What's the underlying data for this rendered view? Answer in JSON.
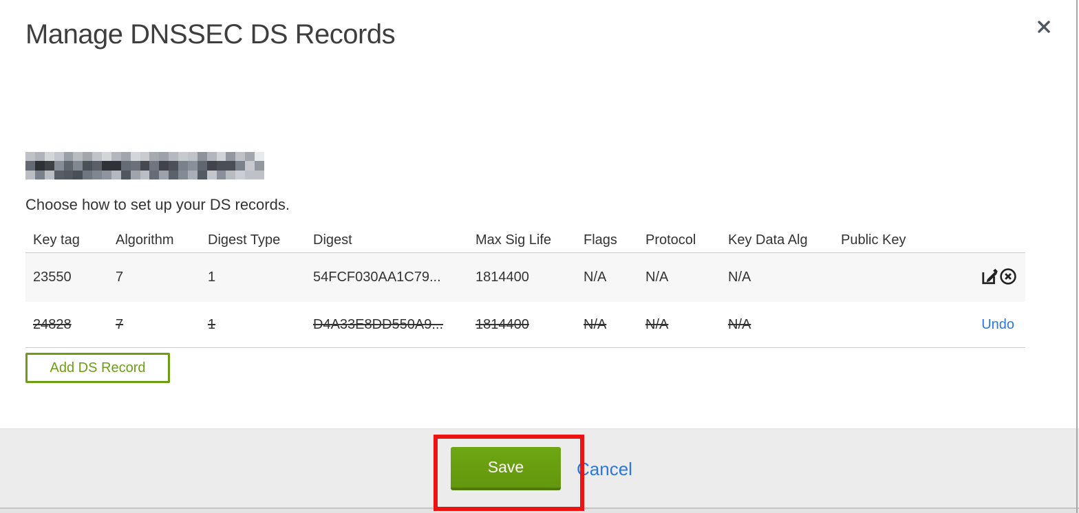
{
  "modal": {
    "title": "Manage DNSSEC DS Records",
    "close_icon": "x-icon",
    "domain": {
      "redacted": true
    },
    "subtitle": "Choose how to set up your DS records.",
    "table": {
      "columns": [
        "Key tag",
        "Algorithm",
        "Digest Type",
        "Digest",
        "Max Sig Life",
        "Flags",
        "Protocol",
        "Key Data Alg",
        "Public Key"
      ],
      "rows": [
        {
          "key_tag": "23550",
          "algorithm": "7",
          "digest_type": "1",
          "digest": "54FCF030AA1C79...",
          "max_sig_life": "1814400",
          "flags": "N/A",
          "protocol": "N/A",
          "key_data_alg": "N/A",
          "public_key": "",
          "deleted": false,
          "actions": [
            "edit",
            "delete"
          ]
        },
        {
          "key_tag": "24828",
          "algorithm": "7",
          "digest_type": "1",
          "digest": "D4A33E8DD550A9...",
          "max_sig_life": "1814400",
          "flags": "N/A",
          "protocol": "N/A",
          "key_data_alg": "N/A",
          "public_key": "",
          "deleted": true,
          "actions": [
            "undo"
          ],
          "undo_label": "Undo"
        }
      ]
    },
    "add_button_label": "Add DS Record",
    "footer": {
      "save_label": "Save",
      "cancel_label": "Cancel"
    },
    "colors": {
      "action_green": "#6b9e12",
      "save_button_green": "#69a010",
      "link_blue": "#2c77e0",
      "annotation_red": "#ec1313",
      "footer_gray": "#ececec",
      "row_stripe_gray": "#f7f7f7"
    }
  }
}
